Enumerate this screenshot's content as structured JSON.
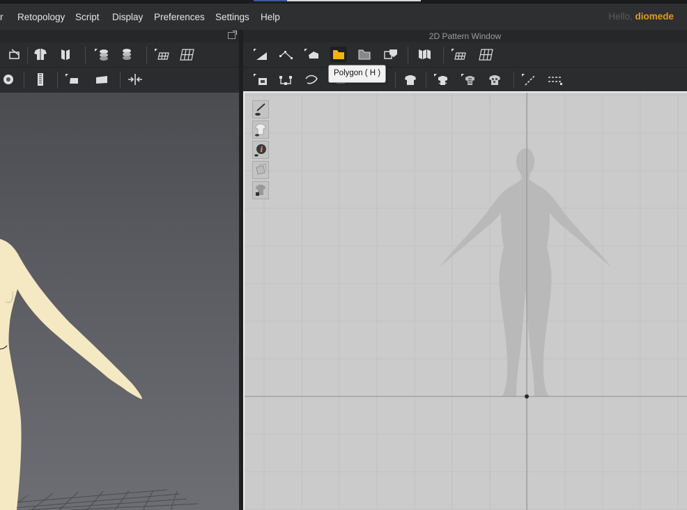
{
  "menubar": {
    "items": [
      "r",
      "Retopology",
      "Script",
      "Display",
      "Preferences",
      "Settings",
      "Help"
    ],
    "greeting_prefix": "Hello,",
    "username": "diomede"
  },
  "pattern_window": {
    "title": "2D Pattern Window"
  },
  "tooltip": {
    "text": "Polygon ( H )"
  },
  "toolbars": {
    "left_row1": [
      "segment-sewing-icon",
      "mannequin-icon",
      "fold-icon",
      "tack-icon",
      "layer-icon",
      "grid-select-icon",
      "grid-icon"
    ],
    "left_row2": [
      "lock-icon",
      "zipper-icon",
      "button-icon",
      "flatten-icon",
      "pin-icon"
    ],
    "right_row1": [
      "transform-pattern-icon",
      "edit-pattern-icon",
      "edit-curvature-icon",
      "polygon-icon",
      "rectangle-icon",
      "internal-polygon-icon",
      "fold-arrangement-icon",
      "grid-select-icon",
      "grid-icon"
    ],
    "right_row2": [
      "select-mesh-icon",
      "edit-point-icon",
      "curve-point-icon",
      "trace-icon",
      "garment-icon",
      "sewing-icon",
      "avatar-icon",
      "checker-icon",
      "tape-icon",
      "ruler-icon"
    ],
    "active_tool": "polygon-icon",
    "accent_color": "#f2b21a"
  },
  "side_tools": [
    "pencil-eye-icon",
    "shirt-eye-icon",
    "info-icon",
    "layers-icon",
    "shirt-lock-icon"
  ],
  "colors": {
    "background": "#2b2c2e",
    "pattern_bg": "#cbcbcb",
    "avatar_skin": "#f4e9c2",
    "accent": "#e59a1c"
  }
}
